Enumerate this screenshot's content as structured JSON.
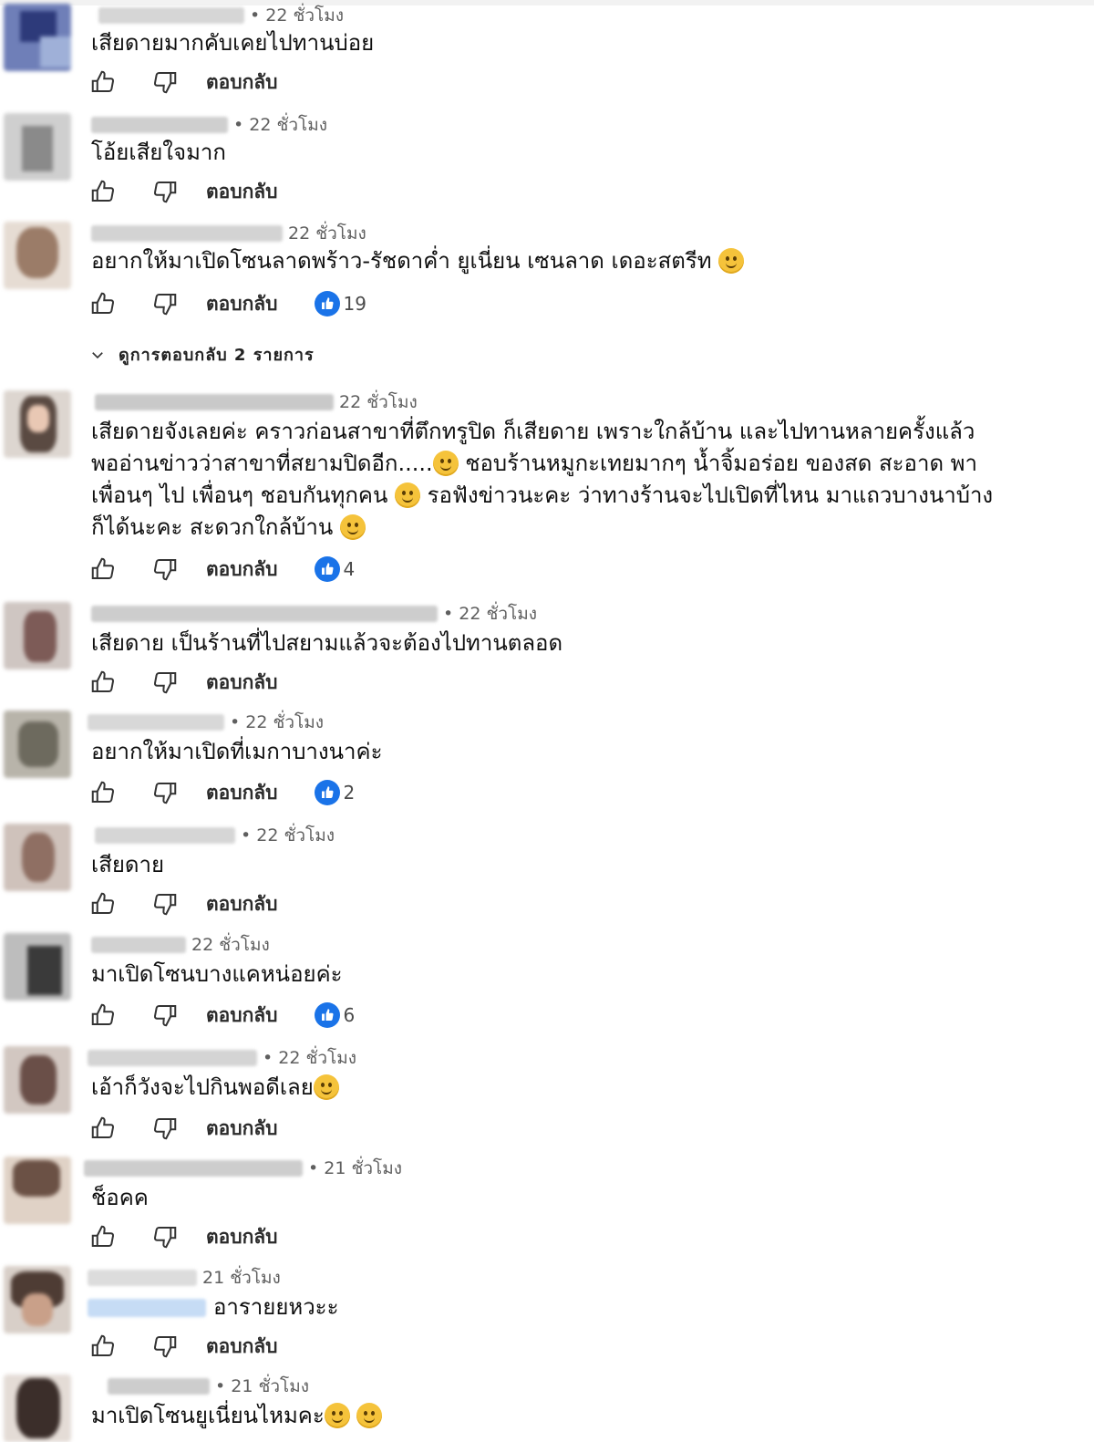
{
  "labels": {
    "reply": "ตอบกลับ",
    "view_replies": "ดูการตอบกลับ 2 รายการ"
  },
  "colors": {
    "heart_badge": "#1a73e8",
    "time_text": "#5f5f5f",
    "reply_text": "#2b2b2b"
  },
  "comments": [
    {
      "time": "• 22 ชั่วโมง",
      "text": "เสียดายมากคับเคยไปทานบ่อย",
      "likes": ""
    },
    {
      "time": "• 22 ชั่วโมง",
      "text": "โอ้ยเสียใจมาก",
      "likes": ""
    },
    {
      "time": "22 ชั่วโมง",
      "text": "อยากให้มาเปิดโซนลาดพร้าว-รัชดาค่ำ ยูเนี่ยน เซนลาด เดอะสตรีท",
      "likes": "19",
      "emoji": "emoji-sad-face"
    },
    {
      "time": "22 ชั่วโมง",
      "text_lines": [
        "เสียดายจังเลยค่ะ คราวก่อนสาขาที่ตึกทรูปิด ก็เสียดาย เพราะใกล้บ้าน และไปทานหลายครั้งแล้ว",
        "พออ่านข่าวว่าสาขาที่สยามปิดอีก.....",
        " ชอบร้านหมูกะเทยมากๆ น้ำจิ้มอร่อย ของสด สะอาด พา",
        "เพื่อนๆ ไป เพื่อนๆ ชอบกันทุกคน ",
        " รอฟังข่าวนะคะ ว่าทางร้านจะไปเปิดที่ไหน มาแถวบางนาบ้าง",
        "ก็ได้นะคะ สะดวกใกล้บ้าน "
      ],
      "likes": "4"
    },
    {
      "time": "• 22 ชั่วโมง",
      "text": "เสียดาย เป็นร้านที่ไปสยามแล้วจะต้องไปทานตลอด",
      "likes": ""
    },
    {
      "time": "• 22 ชั่วโมง",
      "text": "อยากให้มาเปิดที่เมกาบางนาค่ะ",
      "likes": "2"
    },
    {
      "time": "• 22 ชั่วโมง",
      "text": "เสียดาย",
      "likes": ""
    },
    {
      "time": "22 ชั่วโมง",
      "text": "มาเปิดโซนบางแคหน่อยค่ะ",
      "likes": "6"
    },
    {
      "time": "• 22 ชั่วโมง",
      "text": "เอ้าก็วังจะไปกินพอดีเลย",
      "likes": "",
      "emoji": "emoji-smile-face"
    },
    {
      "time": "• 21 ชั่วโมง",
      "text": "ช็อคค",
      "likes": ""
    },
    {
      "time": "21 ชั่วโมง",
      "text": "อารายยหวะะ",
      "likes": ""
    },
    {
      "time": "• 21 ชั่วโมง",
      "text": "มาเปิดโซนยูเนี่ยนไหมคะ",
      "likes": "",
      "emoji": "emoji-sad-face"
    }
  ]
}
